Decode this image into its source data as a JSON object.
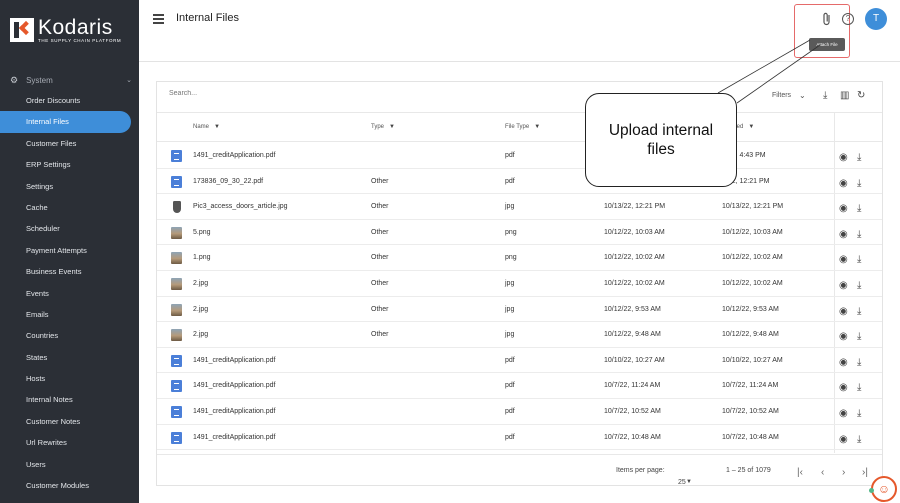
{
  "brand": {
    "name": "Kodaris",
    "tagline": "THE SUPPLY CHAIN PLATFORM",
    "accent": "#3e8ed9",
    "logo_orange": "#e5582b"
  },
  "sidebar": {
    "section": "System",
    "items": [
      {
        "label": "Order Discounts"
      },
      {
        "label": "Internal Files",
        "active": true
      },
      {
        "label": "Customer Files"
      },
      {
        "label": "ERP Settings"
      },
      {
        "label": "Settings"
      },
      {
        "label": "Cache"
      },
      {
        "label": "Scheduler"
      },
      {
        "label": "Payment Attempts"
      },
      {
        "label": "Business Events"
      },
      {
        "label": "Events"
      },
      {
        "label": "Emails"
      },
      {
        "label": "Countries"
      },
      {
        "label": "States"
      },
      {
        "label": "Hosts"
      },
      {
        "label": "Internal Notes"
      },
      {
        "label": "Customer Notes"
      },
      {
        "label": "Url Rewrites"
      },
      {
        "label": "Users"
      },
      {
        "label": "Customer Modules"
      }
    ]
  },
  "header": {
    "title": "Internal Files",
    "tooltip": "Attach File",
    "avatar_initial": "T",
    "icons": [
      "menu-icon",
      "paperclip-icon",
      "help-icon"
    ]
  },
  "table": {
    "search_placeholder": "Search...",
    "filters_label": "Filters",
    "columns": {
      "name": "Name",
      "type": "Type",
      "file_type": "File Type",
      "updated": "ted"
    },
    "rows": [
      {
        "icon": "doc",
        "name": "1491_creditApplication.pdf",
        "type": "",
        "file_type": "pdf",
        "created": "",
        "updated": "4/22, 4:43 PM"
      },
      {
        "icon": "doc",
        "name": "173836_09_30_22.pdf",
        "type": "Other",
        "file_type": "pdf",
        "created": "",
        "updated": "3/22, 12:21 PM"
      },
      {
        "icon": "shield",
        "name": "Pic3_access_doors_article.jpg",
        "type": "Other",
        "file_type": "jpg",
        "created": "10/13/22, 12:21 PM",
        "updated": "10/13/22, 12:21 PM"
      },
      {
        "icon": "img",
        "name": "5.png",
        "type": "Other",
        "file_type": "png",
        "created": "10/12/22, 10:03 AM",
        "updated": "10/12/22, 10:03 AM"
      },
      {
        "icon": "img",
        "name": "1.png",
        "type": "Other",
        "file_type": "png",
        "created": "10/12/22, 10:02 AM",
        "updated": "10/12/22, 10:02 AM"
      },
      {
        "icon": "img",
        "name": "2.jpg",
        "type": "Other",
        "file_type": "jpg",
        "created": "10/12/22, 10:02 AM",
        "updated": "10/12/22, 10:02 AM"
      },
      {
        "icon": "img",
        "name": "2.jpg",
        "type": "Other",
        "file_type": "jpg",
        "created": "10/12/22, 9:53 AM",
        "updated": "10/12/22, 9:53 AM"
      },
      {
        "icon": "img",
        "name": "2.jpg",
        "type": "Other",
        "file_type": "jpg",
        "created": "10/12/22, 9:48 AM",
        "updated": "10/12/22, 9:48 AM"
      },
      {
        "icon": "doc",
        "name": "1491_creditApplication.pdf",
        "type": "",
        "file_type": "pdf",
        "created": "10/10/22, 10:27 AM",
        "updated": "10/10/22, 10:27 AM"
      },
      {
        "icon": "doc",
        "name": "1491_creditApplication.pdf",
        "type": "",
        "file_type": "pdf",
        "created": "10/7/22, 11:24 AM",
        "updated": "10/7/22, 11:24 AM"
      },
      {
        "icon": "doc",
        "name": "1491_creditApplication.pdf",
        "type": "",
        "file_type": "pdf",
        "created": "10/7/22, 10:52 AM",
        "updated": "10/7/22, 10:52 AM"
      },
      {
        "icon": "doc",
        "name": "1491_creditApplication.pdf",
        "type": "",
        "file_type": "pdf",
        "created": "10/7/22, 10:48 AM",
        "updated": "10/7/22, 10:48 AM"
      }
    ],
    "footer": {
      "items_per_page_label": "Items per page:",
      "items_per_page": "25",
      "range": "1 – 25 of 1079"
    }
  },
  "callout": {
    "line1": "Upload internal",
    "line2": "files"
  }
}
